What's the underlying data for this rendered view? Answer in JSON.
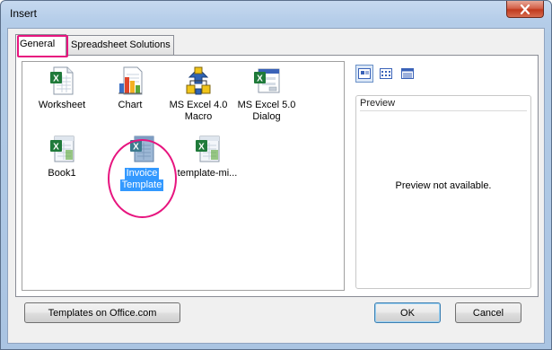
{
  "window": {
    "title": "Insert"
  },
  "tabs": [
    {
      "label": "General",
      "active": true
    },
    {
      "label": "Spreadsheet Solutions",
      "active": false
    }
  ],
  "templates": [
    {
      "label": "Worksheet",
      "icon": "excel-worksheet-icon",
      "selected": false
    },
    {
      "label": "Chart",
      "icon": "chart-icon",
      "selected": false
    },
    {
      "label": "MS Excel 4.0 Macro",
      "line1": "MS Excel 4.0",
      "line2": "Macro",
      "icon": "excel-macro-icon",
      "selected": false
    },
    {
      "label": "MS Excel 5.0 Dialog",
      "line1": "MS Excel 5.0",
      "line2": "Dialog",
      "icon": "excel-dialog-icon",
      "selected": false
    },
    {
      "label": "Book1",
      "icon": "excel-template-icon",
      "selected": false
    },
    {
      "label": "Invoice Template",
      "line1": "Invoice",
      "line2": "Template",
      "icon": "excel-template-icon",
      "selected": true
    },
    {
      "label": "template-mi...",
      "icon": "excel-template-icon",
      "selected": false
    }
  ],
  "view_buttons": [
    {
      "name": "large-icons-view-icon",
      "active": true
    },
    {
      "name": "list-view-icon",
      "active": false
    },
    {
      "name": "details-view-icon",
      "active": false
    }
  ],
  "preview": {
    "title": "Preview",
    "message": "Preview not available."
  },
  "buttons": {
    "templates_online": "Templates on Office.com",
    "ok": "OK",
    "cancel": "Cancel"
  },
  "colors": {
    "selection": "#3399ff",
    "annotation": "#e7157f",
    "excel_green": "#1f7a3a",
    "close_red": "#c13a1e"
  }
}
